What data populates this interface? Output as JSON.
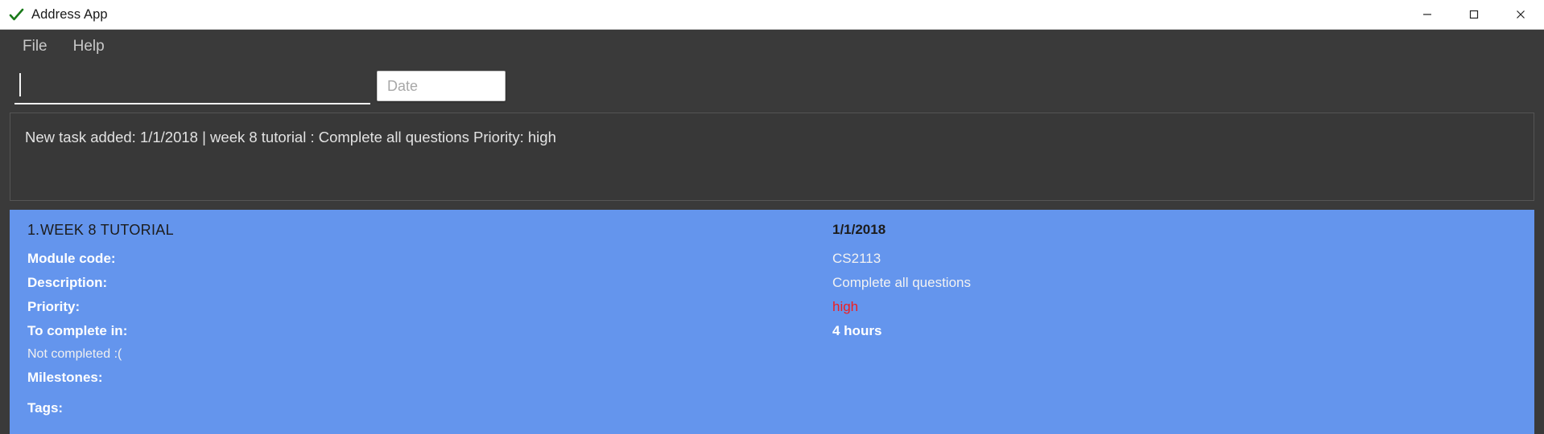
{
  "window": {
    "title": "Address App",
    "app_icon": "check-icon",
    "accent_color": "#6495ed",
    "background_color": "#3a3a3a",
    "controls": {
      "minimize": "minimize-icon",
      "maximize": "maximize-icon",
      "close": "close-icon"
    }
  },
  "menu": {
    "items": [
      {
        "label": "File"
      },
      {
        "label": "Help"
      }
    ]
  },
  "command": {
    "input_value": "",
    "input_placeholder": "",
    "date": {
      "value": "",
      "placeholder": "Date",
      "button_icon": "calendar-icon"
    }
  },
  "log": {
    "messages": [
      "New task added: 1/1/2018 | week 8 tutorial : Complete all questions Priority: high"
    ]
  },
  "task": {
    "index": "1.",
    "title": "WEEK 8 TUTORIAL",
    "date": "1/1/2018",
    "status_text": "Not completed :(",
    "fields": [
      {
        "label": "Module code:",
        "value": "CS2113"
      },
      {
        "label": "Description:",
        "value": "Complete all questions"
      },
      {
        "label": "Priority:",
        "value": "high"
      },
      {
        "label": "To complete in:",
        "value": "4 hours"
      }
    ],
    "milestones_label": "Milestones:",
    "milestones_value": "",
    "tags_label": "Tags:",
    "tags_value": "",
    "priority_color": "#f21d1d"
  }
}
